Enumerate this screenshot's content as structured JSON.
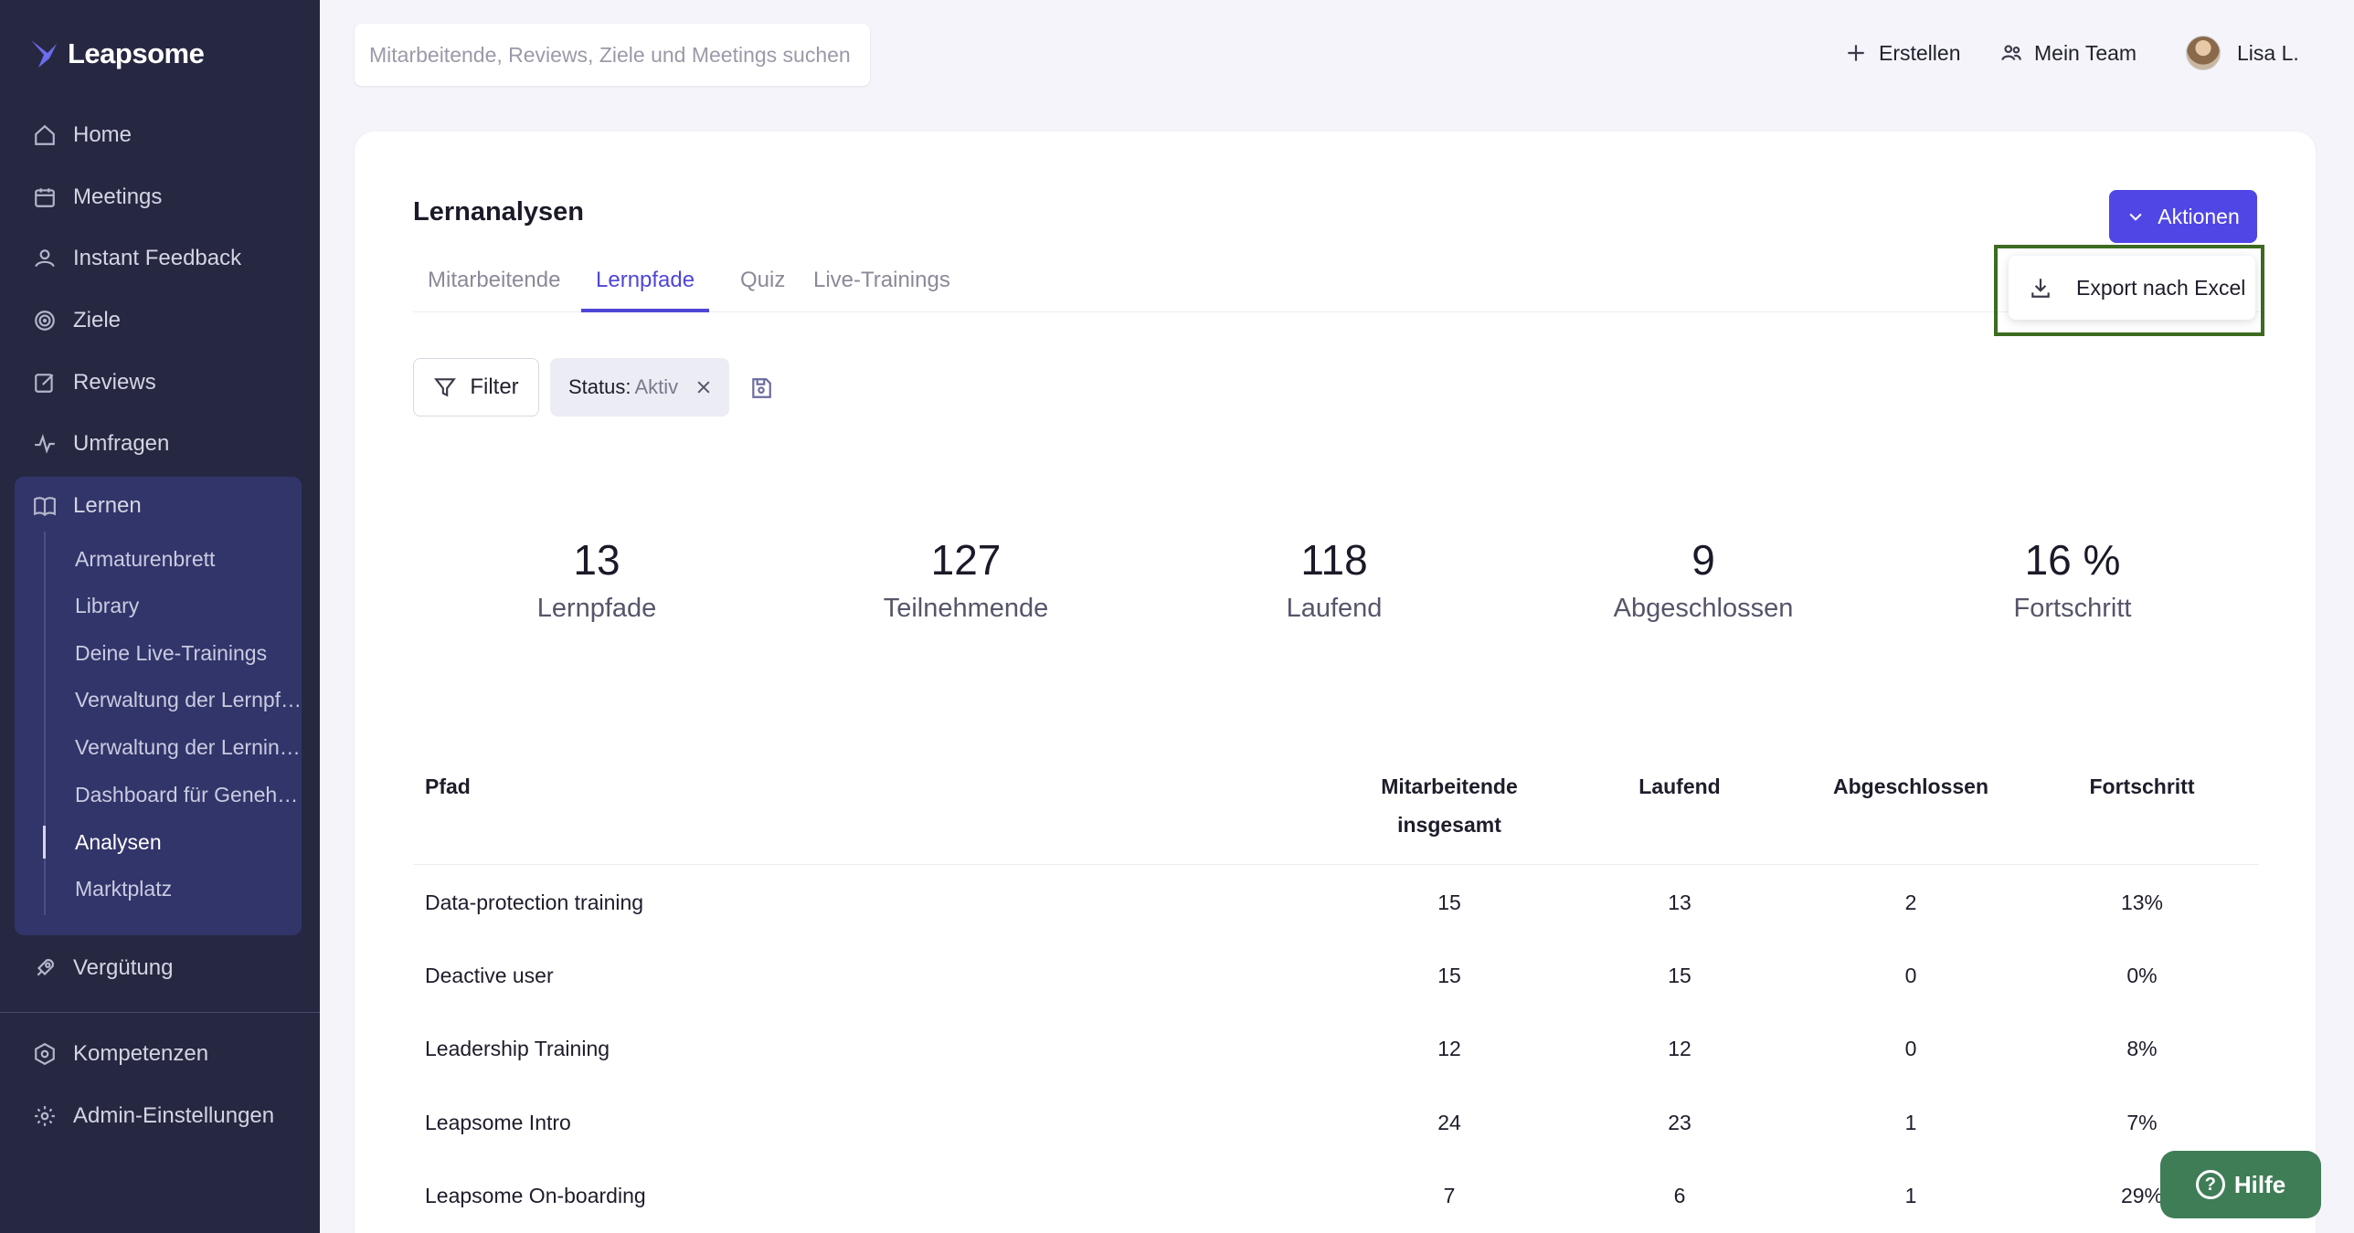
{
  "app": {
    "brand": "Leapsome"
  },
  "sidebar": {
    "items": [
      {
        "label": "Home",
        "icon": "home-icon"
      },
      {
        "label": "Meetings",
        "icon": "calendar-icon"
      },
      {
        "label": "Instant Feedback",
        "icon": "feedback-icon"
      },
      {
        "label": "Ziele",
        "icon": "target-icon"
      },
      {
        "label": "Reviews",
        "icon": "edit-icon"
      },
      {
        "label": "Umfragen",
        "icon": "pulse-icon"
      },
      {
        "label": "Lernen",
        "icon": "book-icon"
      },
      {
        "label": "Vergütung",
        "icon": "rocket-icon"
      },
      {
        "label": "Kompetenzen",
        "icon": "competency-icon"
      },
      {
        "label": "Admin-Einstellungen",
        "icon": "gear-icon"
      }
    ],
    "learn_sub": [
      "Armaturenbrett",
      "Library",
      "Deine Live-Trainings",
      "Verwaltung der Lernpfade",
      "Verwaltung der Lerninhalte",
      "Dashboard für Genehmigungen",
      "Analysen",
      "Marktplatz"
    ]
  },
  "topbar": {
    "search_placeholder": "Mitarbeitende, Reviews, Ziele und Meetings suchen",
    "create": "Erstellen",
    "my_team": "Mein Team",
    "user": "Lisa L."
  },
  "page": {
    "title": "Lernanalysen",
    "tabs": [
      "Mitarbeitende",
      "Lernpfade",
      "Quiz",
      "Live-Trainings"
    ],
    "actions_button": "Aktionen",
    "dropdown_item": "Export nach Excel",
    "filter_button": "Filter",
    "chip_key": "Status:",
    "chip_value": "Aktiv"
  },
  "stats": [
    {
      "value": "13",
      "label": "Lernpfade"
    },
    {
      "value": "127",
      "label": "Teilnehmende"
    },
    {
      "value": "118",
      "label": "Laufend"
    },
    {
      "value": "9",
      "label": "Abgeschlossen"
    },
    {
      "value": "16 %",
      "label": "Fortschritt"
    }
  ],
  "table": {
    "headers": [
      "Pfad",
      "Mitarbeitende insgesamt",
      "Laufend",
      "Abgeschlossen",
      "Fortschritt"
    ],
    "rows": [
      [
        "Data-protection training",
        "15",
        "13",
        "2",
        "13%"
      ],
      [
        "Deactive user",
        "15",
        "15",
        "0",
        "0%"
      ],
      [
        "Leadership Training",
        "12",
        "12",
        "0",
        "8%"
      ],
      [
        "Leapsome Intro",
        "24",
        "23",
        "1",
        "7%"
      ],
      [
        "Leapsome On-boarding",
        "7",
        "6",
        "1",
        "29%"
      ]
    ]
  },
  "help": {
    "label": "Hilfe"
  },
  "colors": {
    "accent": "#4f46e5",
    "sidebar": "#262842",
    "help": "#3f7d57",
    "highlight": "#3d6b22"
  }
}
